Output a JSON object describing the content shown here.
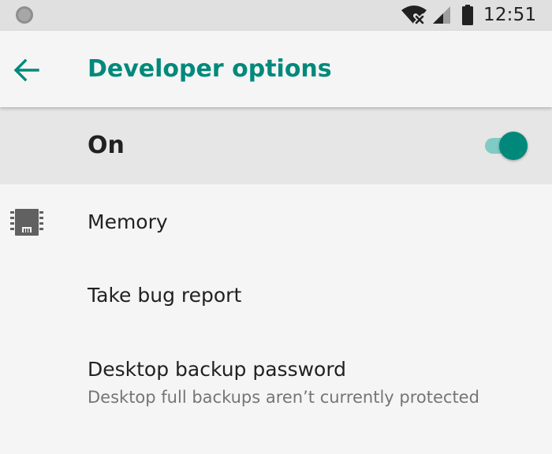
{
  "status_bar": {
    "time": "12:51",
    "icons": [
      "notification-dot-icon",
      "wifi-no-internet-icon",
      "cell-signal-icon",
      "battery-icon"
    ]
  },
  "app_bar": {
    "back_icon": "arrow-back-icon",
    "title": "Developer options"
  },
  "master_switch": {
    "label": "On",
    "checked": true
  },
  "list": {
    "items": [
      {
        "icon": "memory-chip-icon",
        "title": "Memory",
        "summary": ""
      },
      {
        "title": "Take bug report",
        "summary": ""
      },
      {
        "title": "Desktop backup password",
        "summary": "Desktop full backups aren’t currently protected"
      }
    ]
  },
  "colors": {
    "accent": "#00897b",
    "accent_light": "#80cbc4",
    "status_bar_bg": "#e0e0e0",
    "page_bg": "#f5f5f5",
    "master_bar_bg": "#e6e6e6",
    "primary_text": "#212121",
    "secondary_text": "#757575",
    "icon": "#616161"
  }
}
